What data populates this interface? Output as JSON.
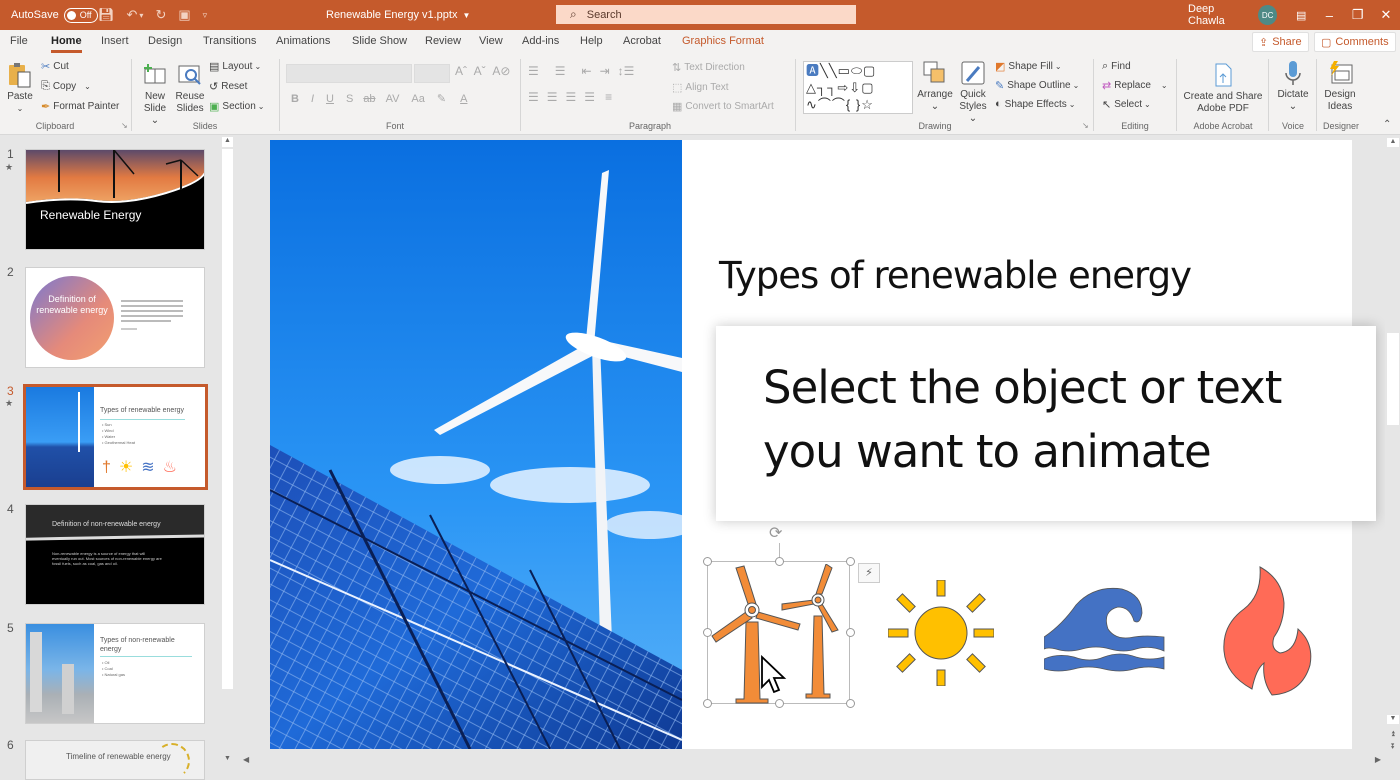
{
  "titlebar": {
    "autosave_label": "AutoSave",
    "autosave_state": "Off",
    "document_title": "Renewable Energy v1.pptx",
    "search_placeholder": "Search",
    "user_name": "Deep Chawla",
    "user_initials": "DC"
  },
  "tabs": [
    {
      "label": "File"
    },
    {
      "label": "Home",
      "active": true
    },
    {
      "label": "Insert"
    },
    {
      "label": "Design"
    },
    {
      "label": "Transitions"
    },
    {
      "label": "Animations"
    },
    {
      "label": "Slide Show"
    },
    {
      "label": "Review"
    },
    {
      "label": "View"
    },
    {
      "label": "Add-ins"
    },
    {
      "label": "Help"
    },
    {
      "label": "Acrobat"
    },
    {
      "label": "Graphics Format",
      "contextual": true
    }
  ],
  "share_label": "Share",
  "comments_label": "Comments",
  "ribbon": {
    "clipboard": {
      "paste": "Paste",
      "cut": "Cut",
      "copy": "Copy",
      "format_painter": "Format Painter",
      "group": "Clipboard"
    },
    "slides": {
      "new_slide_1": "New",
      "new_slide_2": "Slide",
      "reuse_1": "Reuse",
      "reuse_2": "Slides",
      "layout": "Layout",
      "reset": "Reset",
      "section": "Section",
      "group": "Slides"
    },
    "font": {
      "group": "Font",
      "bold": "B",
      "italic": "I",
      "underline": "U",
      "shadow": "S",
      "strike": "ab",
      "spacing": "AV",
      "case": "Aa"
    },
    "paragraph": {
      "text_direction": "Text Direction",
      "align_text": "Align Text",
      "convert_smartart": "Convert to SmartArt",
      "group": "Paragraph"
    },
    "drawing": {
      "arrange": "Arrange",
      "quick_1": "Quick",
      "quick_2": "Styles",
      "shape_fill": "Shape Fill",
      "shape_outline": "Shape Outline",
      "shape_effects": "Shape Effects",
      "group": "Drawing"
    },
    "editing": {
      "find": "Find",
      "replace": "Replace",
      "select": "Select",
      "group": "Editing"
    },
    "acrobat": {
      "line1": "Create and Share",
      "line2": "Adobe PDF",
      "group": "Adobe Acrobat"
    },
    "voice": {
      "dictate": "Dictate",
      "group": "Voice"
    },
    "designer": {
      "line1": "Design",
      "line2": "Ideas",
      "group": "Designer"
    }
  },
  "slides": [
    {
      "number": "1",
      "title": "Renewable Energy",
      "has_animation": true
    },
    {
      "number": "2",
      "title": "Definition of renewable energy",
      "has_animation": false
    },
    {
      "number": "3",
      "title": "Types of renewable energy",
      "bullets": [
        "Sun",
        "Wind",
        "Water",
        "Geothermal Heat"
      ],
      "has_animation": true,
      "selected": true
    },
    {
      "number": "4",
      "title": "Definition of non-renewable energy",
      "body": "Non-renewable energy is a source of energy that will eventually run out. Most sources of non-renewable energy are fossil fuels, such as coal, gas and oil.",
      "has_animation": false
    },
    {
      "number": "5",
      "title": "Types of non-renewable energy",
      "bullets": [
        "Oil",
        "Coal",
        "Natural gas"
      ],
      "has_animation": false
    },
    {
      "number": "6",
      "title": "Timeline of renewable energy",
      "has_animation": false
    }
  ],
  "current_slide": {
    "title": "Types of renewable energy",
    "icons": [
      "wind-turbines",
      "sun",
      "wave",
      "fire"
    ]
  },
  "tooltip": {
    "line1": "Select the object or text",
    "line2": "you want to animate"
  },
  "colors": {
    "accent": "#c55a2c",
    "turbine": "#f28c38",
    "sun": "#ffc000",
    "wave": "#4472c4",
    "fire": "#ff6b57"
  }
}
